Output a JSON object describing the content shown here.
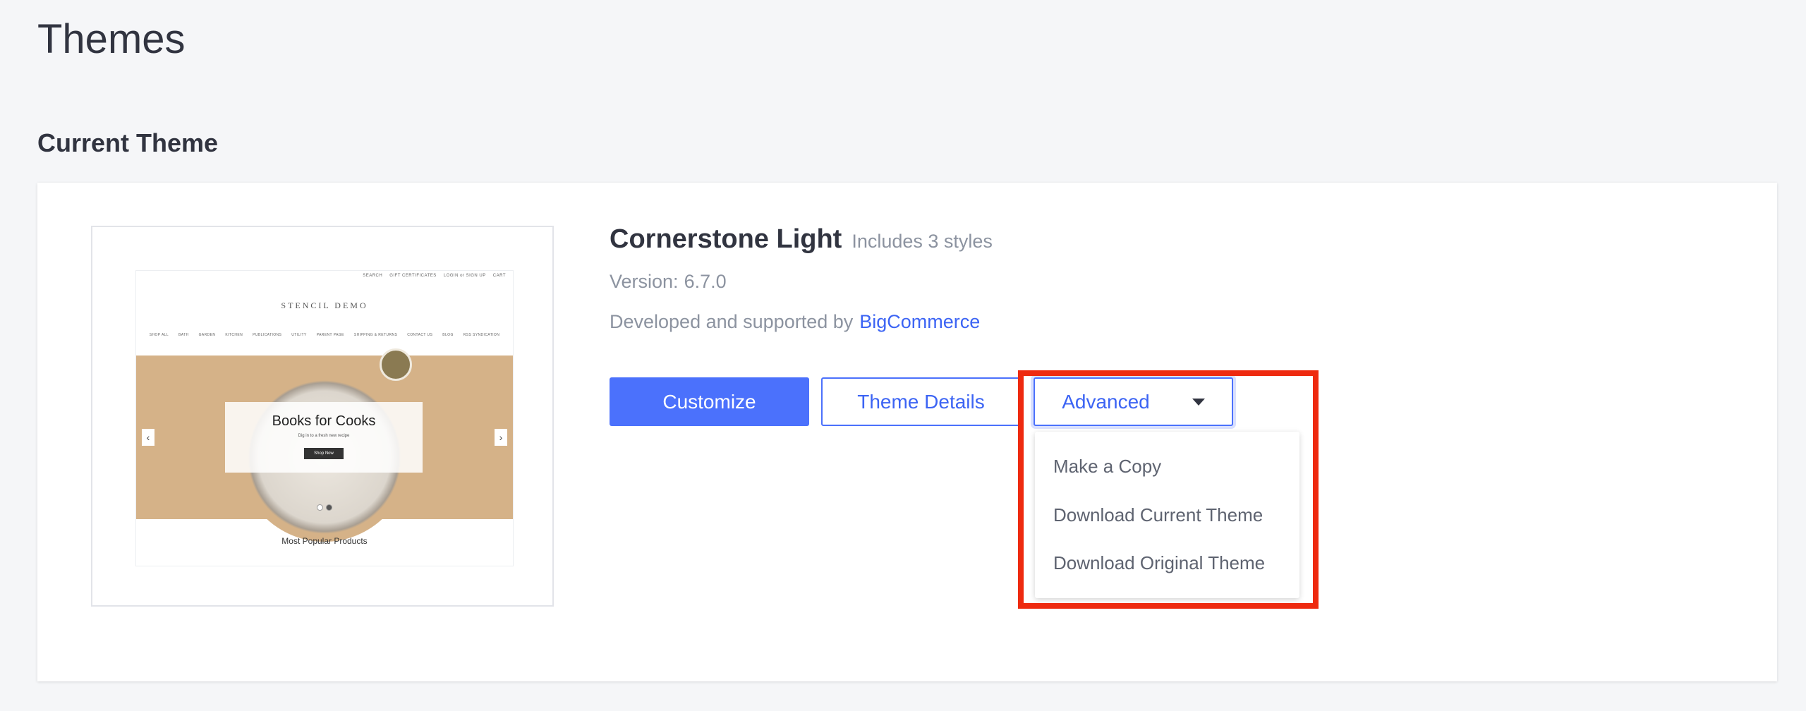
{
  "page": {
    "title": "Themes"
  },
  "section": {
    "title": "Current Theme"
  },
  "preview": {
    "top_nav": [
      "SEARCH",
      "GIFT CERTIFICATES",
      "LOGIN or SIGN UP",
      "CART"
    ],
    "logo": "STENCIL DEMO",
    "main_nav": [
      "SHOP ALL",
      "BATH",
      "GARDEN",
      "KITCHEN",
      "PUBLICATIONS",
      "UTILITY",
      "PARENT PAGE",
      "SHIPPING & RETURNS",
      "CONTACT US",
      "BLOG",
      "RSS SYNDICATION"
    ],
    "banner_title": "Books for Cooks",
    "banner_subtitle": "Dig in to a fresh new recipe",
    "banner_button": "Shop Now",
    "popular": "Most Popular Products"
  },
  "theme": {
    "name": "Cornerstone Light",
    "styles": "Includes 3 styles",
    "version_label": "Version:",
    "version": "6.7.0",
    "developer_label": "Developed and supported by",
    "developer": "BigCommerce"
  },
  "buttons": {
    "customize": "Customize",
    "details": "Theme Details",
    "advanced": "Advanced"
  },
  "dropdown": {
    "items": [
      "Make a Copy",
      "Download Current Theme",
      "Download Original Theme"
    ]
  },
  "colors": {
    "accent": "#4b71fc",
    "link": "#3c64f4",
    "highlight": "#ee2a0f"
  }
}
